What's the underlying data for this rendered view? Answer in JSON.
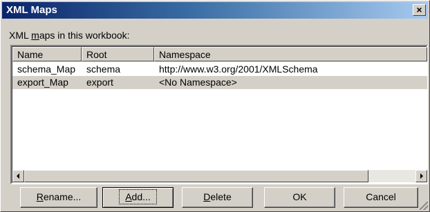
{
  "window": {
    "title": "XML Maps",
    "close_glyph": "×"
  },
  "label": {
    "pre": "XML ",
    "mnemonic": "m",
    "post": "aps in this workbook:"
  },
  "columns": [
    "Name",
    "Root",
    "Namespace"
  ],
  "rows": [
    {
      "name": "schema_Map",
      "root": "schema",
      "namespace": "http://www.w3.org/2001/XMLSchema"
    },
    {
      "name": "export_Map",
      "root": "export",
      "namespace": "<No Namespace>"
    }
  ],
  "buttons": {
    "rename": {
      "mnemonic": "R",
      "rest": "ename..."
    },
    "add": {
      "mnemonic": "A",
      "rest": "dd..."
    },
    "delete": {
      "mnemonic": "D",
      "rest": "elete"
    },
    "ok": {
      "label": "OK"
    },
    "cancel": {
      "label": "Cancel"
    }
  }
}
